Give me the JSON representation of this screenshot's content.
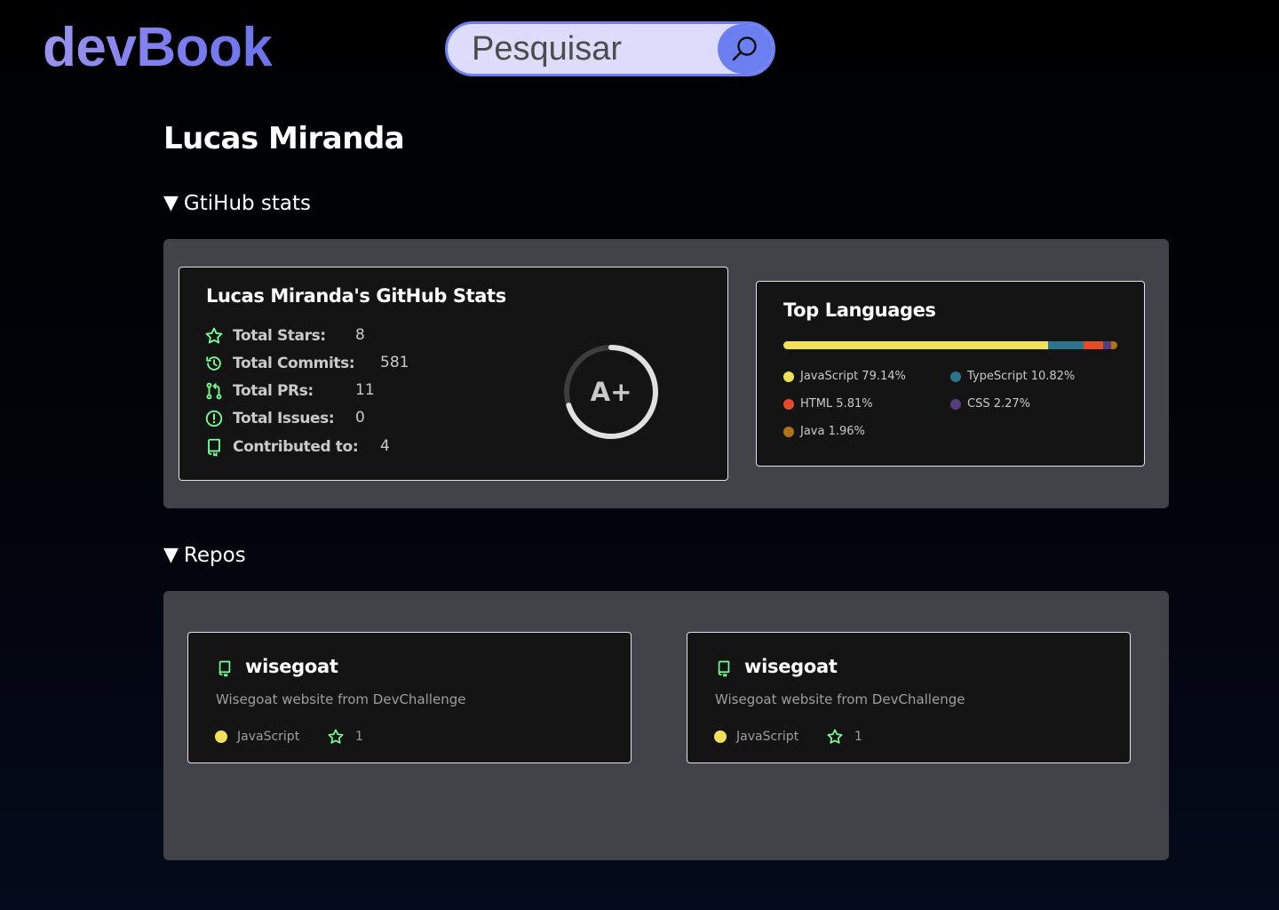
{
  "header": {
    "logo": "devBook",
    "search_placeholder": "Pesquisar",
    "search_icon": "search-icon",
    "accent_color": "#6c7ff0"
  },
  "profile": {
    "name": "Lucas Miranda"
  },
  "sections": {
    "stats_toggle": "GtiHub stats",
    "repos_toggle": "Repos"
  },
  "stats_card": {
    "title": "Lucas Miranda's GitHub Stats",
    "rows": [
      {
        "icon": "star-icon",
        "label": "Total Stars:",
        "value": "8"
      },
      {
        "icon": "commit-history-icon",
        "label": "Total Commits:",
        "value": "581"
      },
      {
        "icon": "pull-request-icon",
        "label": "Total PRs:",
        "value": "11"
      },
      {
        "icon": "issue-icon",
        "label": "Total Issues:",
        "value": "0"
      },
      {
        "icon": "repo-icon",
        "label": "Contributed to:",
        "value": "4"
      }
    ],
    "rank": "A+",
    "rank_progress": 0.7
  },
  "languages_card": {
    "title": "Top Languages",
    "languages": [
      {
        "name": "JavaScript",
        "percent": 79.14,
        "label": "JavaScript 79.14%",
        "color": "#f1e05a"
      },
      {
        "name": "TypeScript",
        "percent": 10.82,
        "label": "TypeScript 10.82%",
        "color": "#2b7489"
      },
      {
        "name": "HTML",
        "percent": 5.81,
        "label": "HTML 5.81%",
        "color": "#e34c26"
      },
      {
        "name": "CSS",
        "percent": 2.27,
        "label": "CSS 2.27%",
        "color": "#563d7c"
      },
      {
        "name": "Java",
        "percent": 1.96,
        "label": "Java 1.96%",
        "color": "#b07219"
      }
    ]
  },
  "repos": [
    {
      "name": "wisegoat",
      "description": "Wisegoat website from DevChallenge",
      "language": "JavaScript",
      "language_color": "#f1e05a",
      "stars": "1"
    },
    {
      "name": "wisegoat",
      "description": "Wisegoat website from DevChallenge",
      "language": "JavaScript",
      "language_color": "#f1e05a",
      "stars": "1"
    }
  ]
}
